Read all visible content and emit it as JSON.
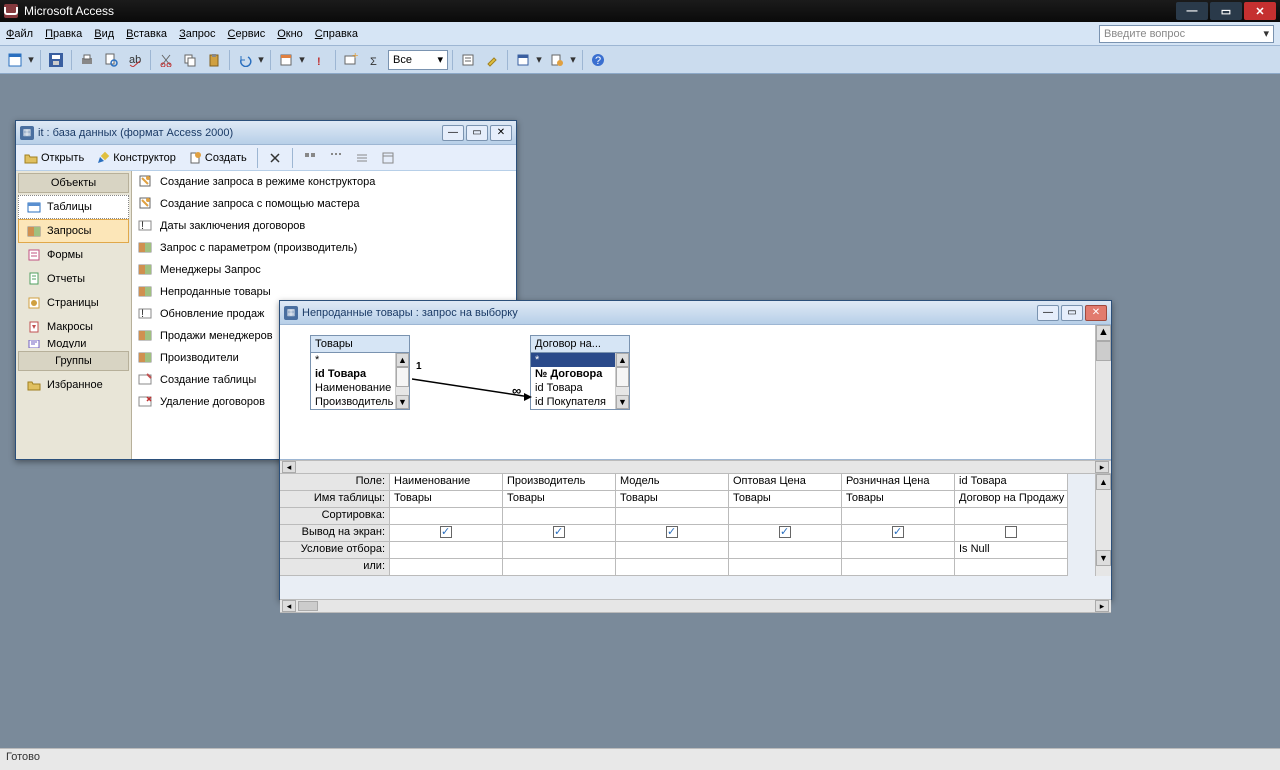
{
  "app": {
    "title": "Microsoft Access"
  },
  "menu": [
    "Файл",
    "Правка",
    "Вид",
    "Вставка",
    "Запрос",
    "Сервис",
    "Окно",
    "Справка"
  ],
  "question_placeholder": "Введите вопрос",
  "toolbar_combo": "Все",
  "status": "Готово",
  "dbwin": {
    "title": "it : база данных (формат Access 2000)",
    "toolbar": {
      "open": "Открыть",
      "design": "Конструктор",
      "new": "Создать"
    },
    "nav_headers": {
      "objects": "Объекты",
      "groups": "Группы"
    },
    "nav_items": [
      "Таблицы",
      "Запросы",
      "Формы",
      "Отчеты",
      "Страницы",
      "Макросы",
      "Модули"
    ],
    "nav_favorites": "Избранное",
    "nav_selected_index": 1,
    "list": [
      "Создание запроса в режиме конструктора",
      "Создание запроса с помощью мастера",
      "Даты заключения договоров",
      "Запрос с параметром (производитель)",
      "Менеджеры Запрос",
      "Непроданные товары",
      "Обновление продаж",
      "Продажи менеджеров",
      "Производители",
      "Создание таблицы",
      "Удаление договоров"
    ]
  },
  "qwin": {
    "title": "Непроданные товары : запрос на выборку",
    "tables": [
      {
        "name": "Товары",
        "fields": [
          "*",
          "id Товара",
          "Наименование",
          "Производитель"
        ],
        "bold": [
          1
        ]
      },
      {
        "name": "Договор на...",
        "fields": [
          "*",
          "№ Договора",
          "id Товара",
          "id Покупателя"
        ],
        "bold": [
          1
        ],
        "selected": 0
      }
    ],
    "relation": {
      "left": "1",
      "right": "∞"
    },
    "grid_labels": [
      "Поле:",
      "Имя таблицы:",
      "Сортировка:",
      "Вывод на экран:",
      "Условие отбора:",
      "или:"
    ],
    "columns": [
      {
        "field": "Наименование",
        "table": "Товары",
        "show": true,
        "criteria": ""
      },
      {
        "field": "Производитель",
        "table": "Товары",
        "show": true,
        "criteria": ""
      },
      {
        "field": "Модель",
        "table": "Товары",
        "show": true,
        "criteria": ""
      },
      {
        "field": "Оптовая Цена",
        "table": "Товары",
        "show": true,
        "criteria": ""
      },
      {
        "field": "Розничная Цена",
        "table": "Товары",
        "show": true,
        "criteria": ""
      },
      {
        "field": "id Товара",
        "table": "Договор на Продажу",
        "show": false,
        "criteria": "Is Null"
      }
    ]
  }
}
